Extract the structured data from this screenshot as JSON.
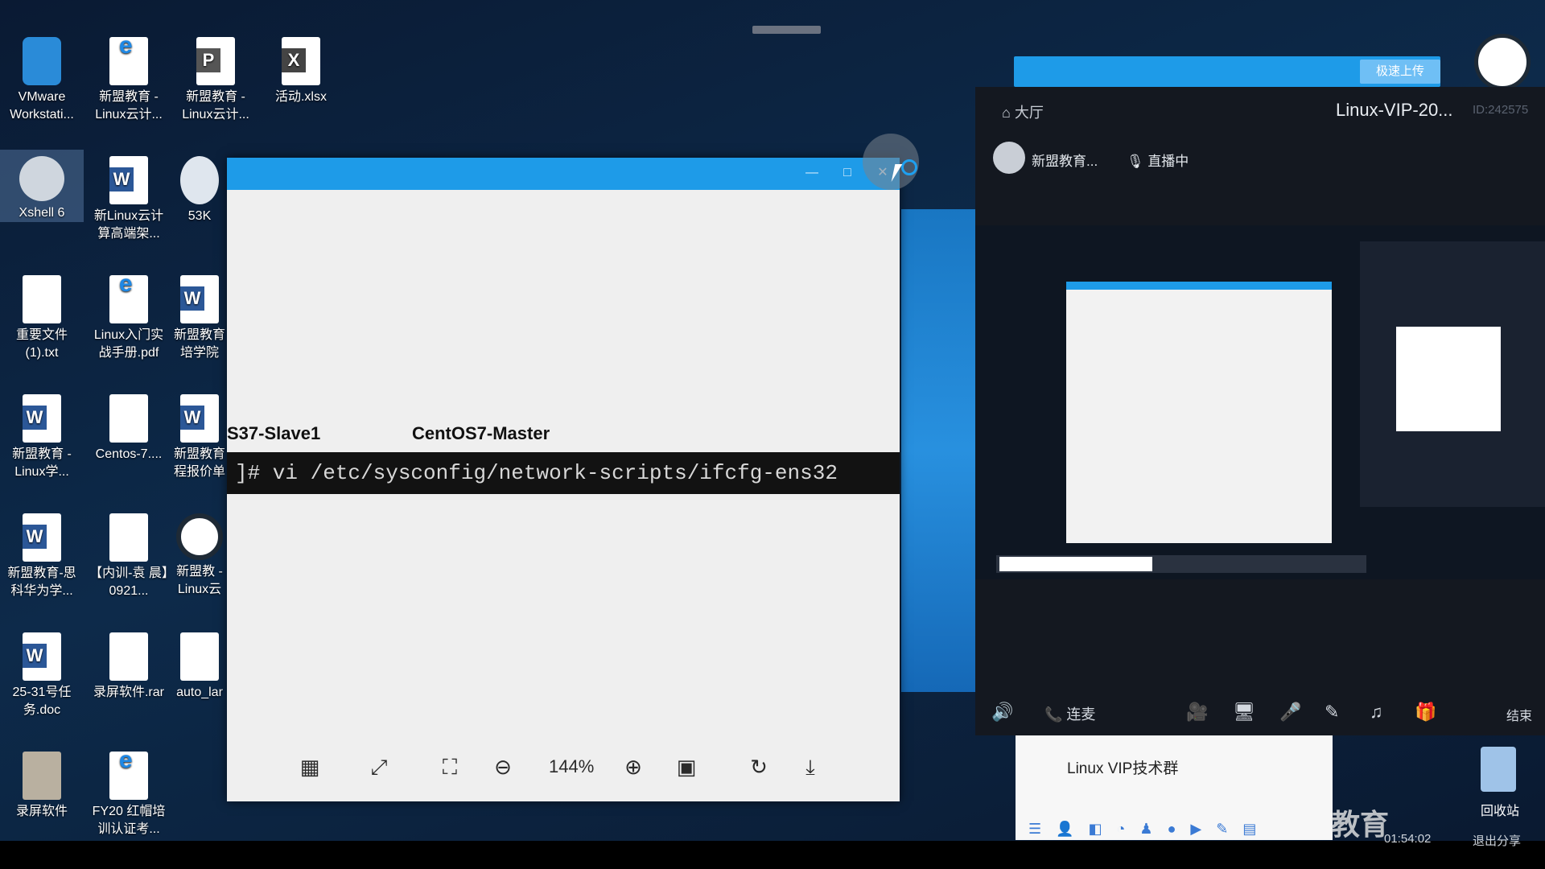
{
  "desktop": {
    "icons": [
      {
        "label": "VMware Workstati..."
      },
      {
        "label": "新盟教育 -Linux云计..."
      },
      {
        "label": "新盟教育 -Linux云计..."
      },
      {
        "label": "活动.xlsx"
      },
      {
        "label": "Xshell 6"
      },
      {
        "label": "新Linux云计 算高端架..."
      },
      {
        "label": "53K"
      },
      {
        "label": "重要文件 (1).txt"
      },
      {
        "label": "Linux入门实 战手册.pdf"
      },
      {
        "label": "新盟教育 培学院"
      },
      {
        "label": "新盟教育 -Linux学..."
      },
      {
        "label": "Centos-7...."
      },
      {
        "label": "新盟教育 程报价单"
      },
      {
        "label": "新盟教育-思 科华为学..."
      },
      {
        "label": "【内训-袁 晨】0921..."
      },
      {
        "label": "新盟教 -Linux云"
      },
      {
        "label": "25-31号任 务.doc"
      },
      {
        "label": "录屏软件.rar"
      },
      {
        "label": "auto_lar"
      },
      {
        "label": "录屏软件"
      },
      {
        "label": "FY20 红帽培 训认证考..."
      }
    ]
  },
  "viewer": {
    "tab_left": "S37-Slave1",
    "tab_right": "CentOS7-Master",
    "terminal_command": "]# vi /etc/sysconfig/network-scripts/ifcfg-ens32",
    "zoom": "144%",
    "window_min": "—",
    "window_max": "□",
    "window_close": "✕"
  },
  "live": {
    "upload_button": "极速上传",
    "breadcrumb": "大厅",
    "title": "Linux-VIP-20...",
    "room_id": "ID:242575",
    "host_name": "新盟教育...",
    "status": "直播中",
    "connect_label": "连麦",
    "end_label": "结束",
    "chat_group": "Linux VIP技术群",
    "elapsed": "01:54:02",
    "share_label": "退出分享"
  },
  "taskbar": {
    "recycle_bin": "回收站",
    "watermark": "教育"
  }
}
